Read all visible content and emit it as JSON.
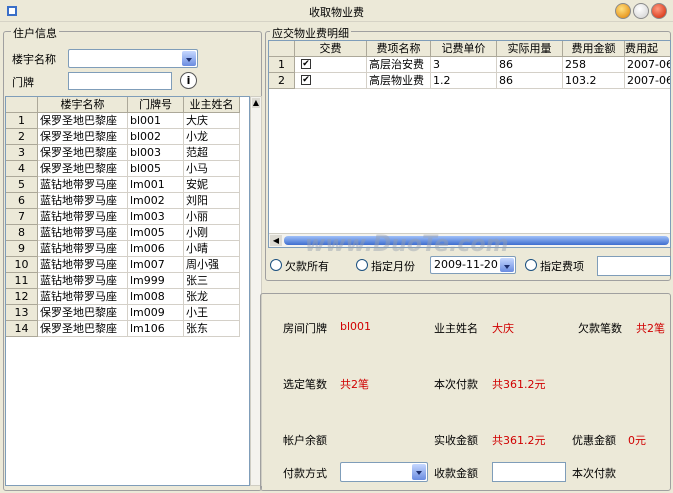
{
  "window": {
    "title": "收取物业费"
  },
  "resident": {
    "group_title": "住户信息",
    "building_label": "楼宇名称",
    "building_value": "",
    "plate_label": "门牌",
    "plate_value": "",
    "columns": [
      "楼宇名称",
      "门牌号",
      "业主姓名"
    ],
    "rows": [
      {
        "n": "1",
        "building": "保罗圣地巴黎座",
        "plate": "bl001",
        "owner": "大庆"
      },
      {
        "n": "2",
        "building": "保罗圣地巴黎座",
        "plate": "bl002",
        "owner": "小龙"
      },
      {
        "n": "3",
        "building": "保罗圣地巴黎座",
        "plate": "bl003",
        "owner": "范超"
      },
      {
        "n": "4",
        "building": "保罗圣地巴黎座",
        "plate": "bl005",
        "owner": "小马"
      },
      {
        "n": "5",
        "building": "蓝钻地带罗马座",
        "plate": "lm001",
        "owner": "安妮"
      },
      {
        "n": "6",
        "building": "蓝钻地带罗马座",
        "plate": "lm002",
        "owner": "刘阳"
      },
      {
        "n": "7",
        "building": "蓝钻地带罗马座",
        "plate": "lm003",
        "owner": "小丽"
      },
      {
        "n": "8",
        "building": "蓝钻地带罗马座",
        "plate": "lm005",
        "owner": "小刚"
      },
      {
        "n": "9",
        "building": "蓝钻地带罗马座",
        "plate": "lm006",
        "owner": "小晴"
      },
      {
        "n": "10",
        "building": "蓝钻地带罗马座",
        "plate": "lm007",
        "owner": "周小强"
      },
      {
        "n": "11",
        "building": "蓝钻地带罗马座",
        "plate": "lm999",
        "owner": "张三"
      },
      {
        "n": "12",
        "building": "蓝钻地带罗马座",
        "plate": "lm008",
        "owner": "张龙"
      },
      {
        "n": "13",
        "building": "保罗圣地巴黎座",
        "plate": "lm009",
        "owner": "小王"
      },
      {
        "n": "14",
        "building": "保罗圣地巴黎座",
        "plate": "lm106",
        "owner": "张东"
      }
    ]
  },
  "fees": {
    "group_title": "应交物业费明细",
    "columns": [
      "交费",
      "费项名称",
      "记费单价",
      "实际用量",
      "费用金额",
      "费用起"
    ],
    "rows": [
      {
        "n": "1",
        "checked": "✔",
        "name": "高层治安费",
        "price": "3",
        "usage": "86",
        "amount": "258",
        "start": "2007-06"
      },
      {
        "n": "2",
        "checked": "✔",
        "name": "高层物业费",
        "price": "1.2",
        "usage": "86",
        "amount": "103.2",
        "start": "2007-06"
      }
    ]
  },
  "filter": {
    "all_arrears": "欠款所有",
    "month": "指定月份",
    "date_value": "2009-11-20",
    "fee_item": "指定费项",
    "fee_item_value": ""
  },
  "summary": {
    "room_label": "房间门牌",
    "room_value": "bl001",
    "owner_label": "业主姓名",
    "owner_value": "大庆",
    "arrears_label": "欠款笔数",
    "arrears_value": "共2笔",
    "selected_label": "选定笔数",
    "selected_value": "共2笔",
    "pay_label": "本次付款",
    "pay_value": "共361.2元",
    "balance_label": "帐户余额",
    "balance_value": "",
    "received_label": "实收金额",
    "received_value": "共361.2元",
    "discount_label": "优惠金额",
    "discount_value": "0元",
    "method_label": "付款方式",
    "method_value": "",
    "collect_label": "收款金额",
    "collect_value": "",
    "change_label": "本次付款"
  },
  "watermark": {
    "text": "www.DuoTe.com"
  },
  "colors": {
    "accent_red": "#d00000",
    "xp_blue": "#7f9db9"
  }
}
